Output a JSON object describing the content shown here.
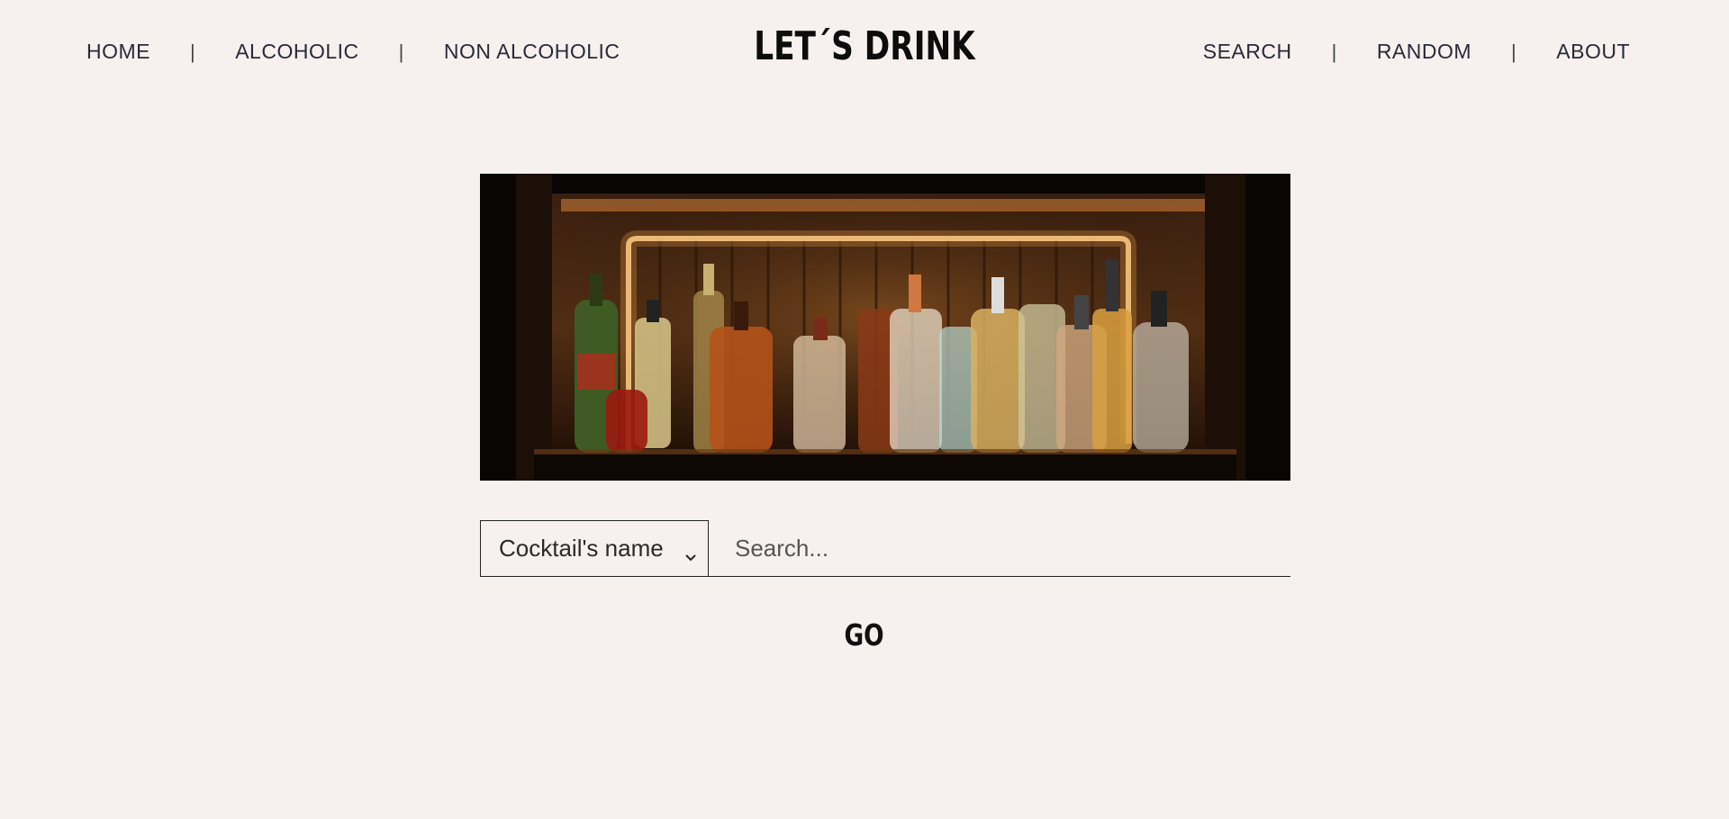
{
  "nav_left": [
    "HOME",
    "ALCOHOLIC",
    "NON ALCOHOLIC"
  ],
  "nav_right": [
    "SEARCH",
    "RANDOM",
    "ABOUT"
  ],
  "separator": "|",
  "logo": "LET´S DRINK",
  "search": {
    "select_value": "Cocktail's name",
    "placeholder": "Search..."
  },
  "go_label": "GO",
  "colors": {
    "background": "#f6f1ee",
    "text": "#2a2a38",
    "logo": "#0c0c0c"
  }
}
